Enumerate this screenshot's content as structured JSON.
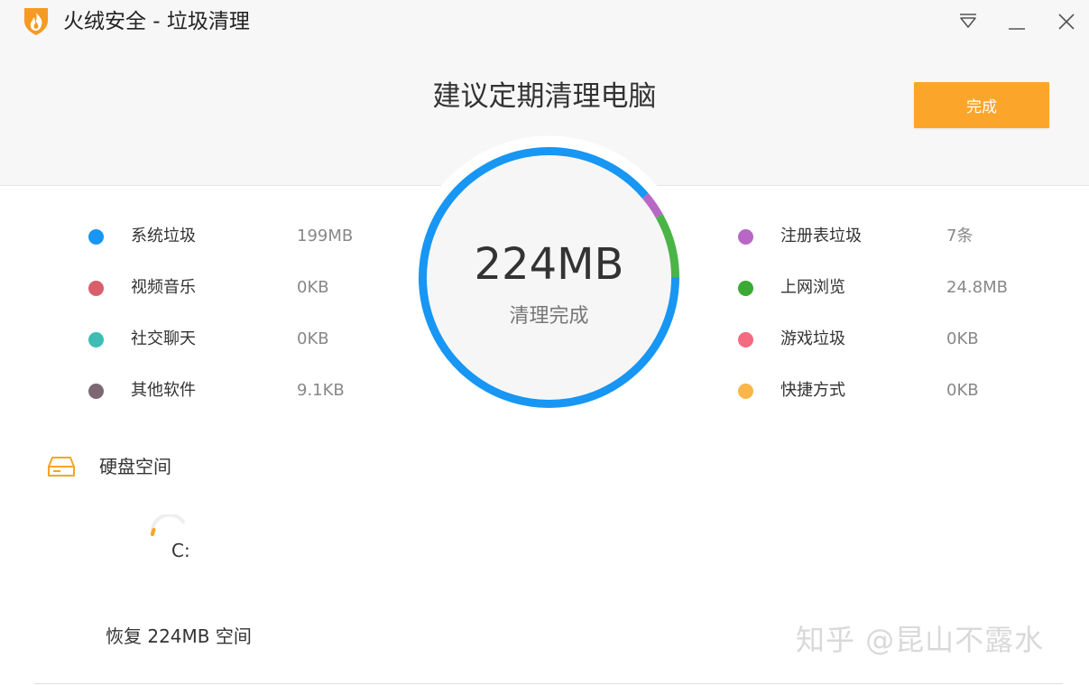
{
  "window": {
    "title": "火绒安全 - 垃圾清理",
    "logo_icon": "huorong-flame-shield-icon",
    "controls": [
      "menu-triangle-icon",
      "minimize-icon",
      "close-icon"
    ]
  },
  "header": {
    "headline": "建议定期清理电脑",
    "done_label": "完成"
  },
  "summary": {
    "total_size": "224MB",
    "status": "清理完成",
    "ring_colors": {
      "primary": "#1796f3",
      "registry": "#b867c6",
      "browser": "#4bb447"
    },
    "ring_fraction": {
      "system": 0.888,
      "registry": 0.031,
      "browser": 0.081
    }
  },
  "categories_left": [
    {
      "name": "系统垃圾",
      "value": "199MB",
      "color": "#1796f3"
    },
    {
      "name": "视频音乐",
      "value": "0KB",
      "color": "#d95f6b"
    },
    {
      "name": "社交聊天",
      "value": "0KB",
      "color": "#3dbdb3"
    },
    {
      "name": "其他软件",
      "value": "9.1KB",
      "color": "#7d6872"
    }
  ],
  "categories_right": [
    {
      "name": "注册表垃圾",
      "value": "7条",
      "color": "#b867c6"
    },
    {
      "name": "上网浏览",
      "value": "24.8MB",
      "color": "#3aaa35"
    },
    {
      "name": "游戏垃圾",
      "value": "0KB",
      "color": "#f26b82"
    },
    {
      "name": "快捷方式",
      "value": "0KB",
      "color": "#fbb548"
    }
  ],
  "disk": {
    "title": "硬盘空间",
    "icon": "hard-disk-icon",
    "drive": "C:",
    "recovered": "恢复 224MB 空间"
  },
  "watermark": "知乎 @昆山不露水",
  "accent_color": "#fba62b"
}
